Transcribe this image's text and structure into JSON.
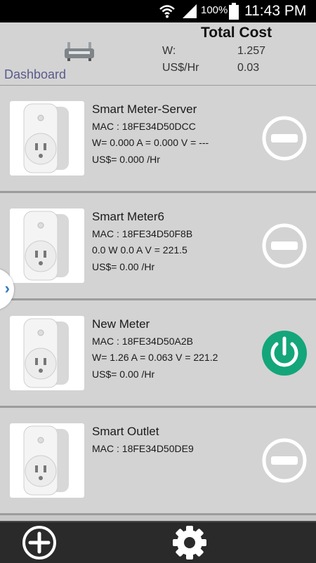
{
  "status_bar": {
    "battery_percent": "100%",
    "time": "11:43 PM"
  },
  "header": {
    "dashboard_label": "Dashboard",
    "total_cost_title": "Total Cost",
    "watts_label": "W:",
    "watts_value": "1.257",
    "rate_label": "US$/Hr",
    "rate_value": "0.03",
    "router_icon": "router-icon"
  },
  "devices": [
    {
      "name": "Smart Meter-Server",
      "mac": "MAC : 18FE34D50DCC",
      "readings": "W= 0.000  A = 0.000 V = ---",
      "cost": "US$= 0.000 /Hr",
      "power_state": "off"
    },
    {
      "name": "Smart Meter6",
      "mac": "MAC : 18FE34D50F8B",
      "readings": "0.0 W 0.0 A V = 221.5",
      "cost": "US$= 0.00 /Hr",
      "power_state": "off"
    },
    {
      "name": "New Meter",
      "mac": "MAC : 18FE34D50A2B",
      "readings": "W= 1.26  A = 0.063 V = 221.2",
      "cost": "US$= 0.00 /Hr",
      "power_state": "on"
    },
    {
      "name": "Smart Outlet",
      "mac": "MAC : 18FE34D50DE9",
      "readings": "",
      "cost": "",
      "power_state": "off"
    }
  ],
  "colors": {
    "on_green": "#13a67a",
    "off_white": "#ffffff",
    "handle_arrow": "#2e7bbf"
  },
  "bottom_bar": {
    "add_icon": "add-circle-icon",
    "settings_icon": "gear-icon"
  }
}
